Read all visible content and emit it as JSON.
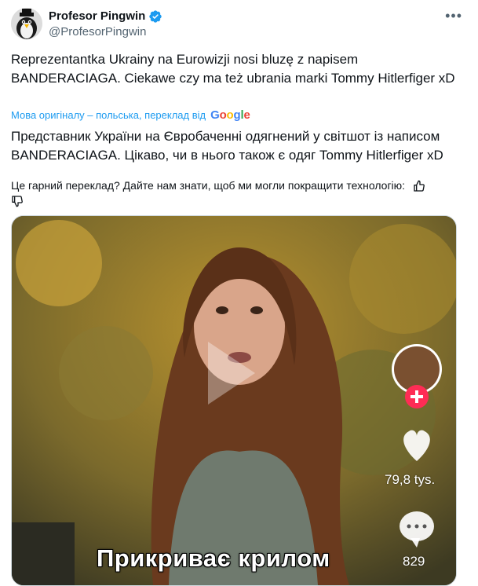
{
  "author": {
    "display_name": "Profesor Pingwin",
    "handle": "@ProfesorPingwin"
  },
  "tweet": {
    "text": "Reprezentantka Ukrainy na Eurowizji nosi bluzę z napisem BANDERACIAGA. Ciekawe czy ma też ubrania marki Tommy Hitlerfiger xD",
    "translation_notice": "Мова оригіналу – польська, переклад від",
    "translation_provider": "Google",
    "translated_text": "Представник України на Євробаченні одягнений у світшот із написом BANDERACIAGA. Цікаво, чи в нього також є одяг Tommy Hitlerfiger xD",
    "feedback_prompt": "Це гарний переклад? Дайте нам знати, щоб ми могли покращити технологію:"
  },
  "media": {
    "overlay_caption": "Прикриває крилом",
    "like_count": "79,8 tys.",
    "comment_count": "829"
  },
  "colors": {
    "link_blue": "#1d9bf0",
    "secondary_text": "#536471",
    "tiktok_pink": "#fe2c55"
  }
}
